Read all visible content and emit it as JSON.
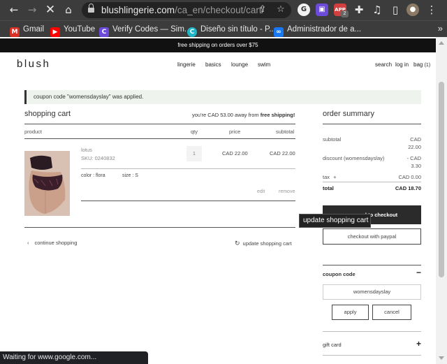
{
  "browser": {
    "url_host": "blushlingerie.com",
    "url_path": "/ca_en/checkout/cart/",
    "ext_badge": "2",
    "bookmarks": [
      {
        "label": "Gmail",
        "icon": "gmail-icon",
        "color": "#d93025"
      },
      {
        "label": "YouTube",
        "icon": "youtube-icon",
        "color": "#ff0000"
      },
      {
        "label": "Verify Codes — Sim...",
        "icon": "verify-icon",
        "color": "#6b4bd8"
      },
      {
        "label": "Diseño sin título - P...",
        "icon": "canva-icon",
        "color": "#1fb5c7"
      },
      {
        "label": "Administrador de a...",
        "icon": "meta-icon",
        "color": "#1877f2"
      }
    ]
  },
  "promo": "free shipping on orders over $75",
  "header": {
    "brand": "blush",
    "nav": [
      "lingerie",
      "basics",
      "lounge",
      "swim"
    ],
    "utility": [
      "search",
      "log in",
      "bag"
    ],
    "bag_count": "(1)"
  },
  "notice": "coupon code \"womensdayslay\" was applied.",
  "cart": {
    "title": "shopping cart",
    "away_prefix": "you're CAD 53.00 away from ",
    "away_bold": "free shipping!",
    "columns": {
      "product": "product",
      "qty": "qty",
      "price": "price",
      "subtotal": "subtotal"
    },
    "item": {
      "name": "lotus",
      "sku": "SKU: 0240832",
      "qty": "1",
      "price": "CAD 22.00",
      "subtotal": "CAD 22.00",
      "color": "color : flora",
      "size": "size : S",
      "edit": "edit",
      "remove": "remove"
    },
    "continue": "continue shopping",
    "update": "update shopping cart"
  },
  "tooltip": "update shopping cart",
  "summary": {
    "title": "order summary",
    "subtotal_label": "subtotal",
    "subtotal_value_1": "CAD",
    "subtotal_value_2": "22.00",
    "discount_label": "discount (womensdayslay)",
    "discount_value_1": "- CAD",
    "discount_value_2": "3.30",
    "tax_label": "tax",
    "tax_value": "CAD 0.00",
    "total_label": "total",
    "total_value": "CAD 18.70",
    "checkout": "proceed to checkout",
    "paypal": "checkout with paypal",
    "coupon_heading": "coupon code",
    "coupon_value": "womensdayslay",
    "apply": "apply",
    "cancel": "cancel",
    "gift_card": "gift card"
  },
  "status": "Waiting for www.google.com..."
}
